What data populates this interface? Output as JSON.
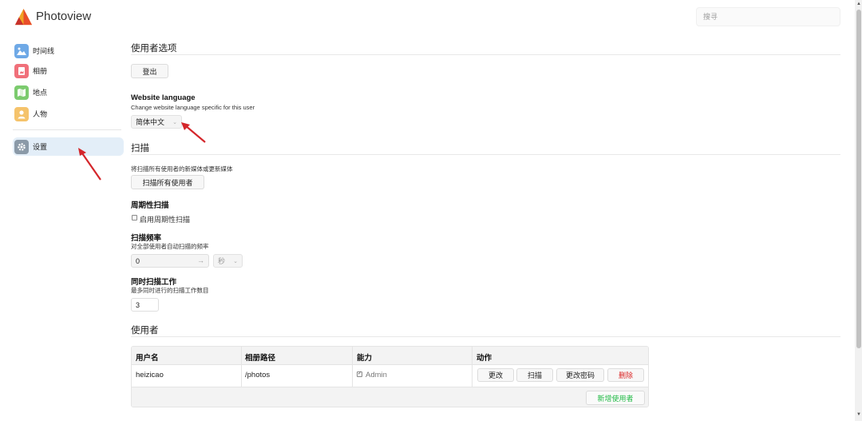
{
  "app": {
    "title": "Photoview",
    "search_placeholder": "搜寻"
  },
  "sidebar": {
    "items": [
      {
        "label": "时间线",
        "icon": "timeline-icon",
        "color": "#6fa9e6"
      },
      {
        "label": "相册",
        "icon": "album-icon",
        "color": "#f0707a"
      },
      {
        "label": "地点",
        "icon": "places-icon",
        "color": "#7ccb6e"
      },
      {
        "label": "人物",
        "icon": "people-icon",
        "color": "#f5c36b"
      },
      {
        "label": "设置",
        "icon": "gear-icon",
        "color": "#8b9aa8",
        "active": true
      }
    ]
  },
  "user_prefs": {
    "heading": "使用者选项",
    "logout_label": "登出",
    "language_title": "Website language",
    "language_desc": "Change website language specific for this user",
    "language_value": "简体中文"
  },
  "scanner": {
    "heading": "扫描",
    "scan_desc": "将扫描所有使用者的新媒体或更新媒体",
    "scan_all_label": "扫描所有使用者",
    "periodic_title": "周期性扫描",
    "periodic_checkbox_label": "启用周期性扫描",
    "periodic_checked": false,
    "freq_title": "扫描频率",
    "freq_desc": "对全部使用者自动扫描的频率",
    "freq_value": "0",
    "freq_unit": "秒",
    "concurrent_title": "同时扫描工作",
    "concurrent_desc": "最多同时进行的扫描工作数目",
    "concurrent_value": "3"
  },
  "users": {
    "heading": "使用者",
    "columns": [
      "用户名",
      "相册路径",
      "能力",
      "动作"
    ],
    "rows": [
      {
        "username": "heizicao",
        "path": "/photos",
        "admin_label": "Admin",
        "admin_checked": true
      }
    ],
    "actions": {
      "edit": "更改",
      "scan": "扫描",
      "change_password": "更改密码",
      "delete": "删除"
    },
    "add_user_label": "新增使用者"
  },
  "colors": {
    "accent_red": "#d4262b",
    "delete_red": "#db2828",
    "add_green": "#21ba45",
    "active_nav_bg": "#e3eef8"
  }
}
